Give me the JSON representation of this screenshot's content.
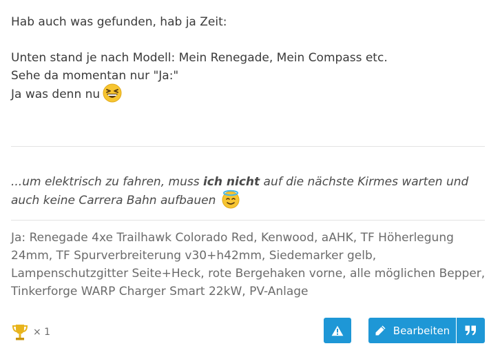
{
  "post": {
    "line1": "Hab auch was gefunden, hab ja Zeit:",
    "line2": "Unten stand je nach Modell: Mein Renegade, Mein Compass etc.",
    "line3": "Sehe da momentan nur \"Ja:\"",
    "line4": "Ja was denn nu",
    "emoji1": "grinning-squinting-face"
  },
  "quote": {
    "part1": "...um elektrisch zu fahren, muss ",
    "bold": "ich nicht",
    "part2": " auf die nächste Kirmes warten und auch keine Carrera Bahn aufbauen",
    "emoji": "smiling-face-with-halo"
  },
  "signature": {
    "text": "Ja: Renegade 4xe Trailhawk Colorado Red, Kenwood, aAHK, TF Höherlegung 24mm, TF Spurverbreiterung v30+h42mm, Siedemarker gelb, Lampenschutzgitter Seite+Heck, rote Bergehaken vorne, alle möglichen Bepper, Tinkerforge WARP Charger Smart 22kW, PV-Anlage"
  },
  "reactions": {
    "icon": "trophy-icon",
    "count": "× 1"
  },
  "actions": {
    "report_icon": "warning-icon",
    "edit_label": "Bearbeiten",
    "edit_icon": "pencil-icon",
    "quote_icon": "quote-icon"
  },
  "colors": {
    "accent": "#1e97d6",
    "text": "#3a3a3a",
    "muted": "#6b6b6b",
    "divider": "#e3e3e3"
  }
}
